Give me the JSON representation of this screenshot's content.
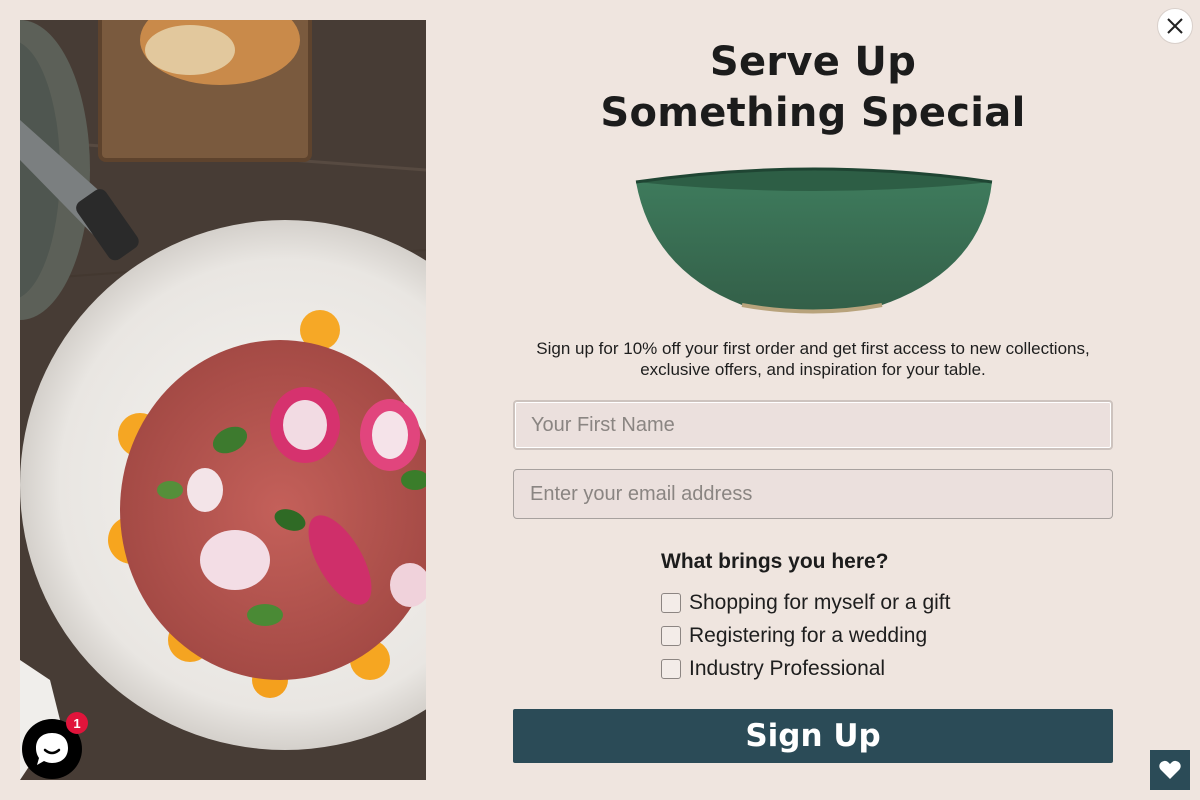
{
  "popup": {
    "headline_line1": "Serve Up",
    "headline_line2": "Something Special",
    "description": "Sign up for 10% off your first order and get first access to new collections, exclusive offers, and inspiration for your table.",
    "first_name_placeholder": "Your First Name",
    "email_placeholder": "Enter your email address",
    "question": "What brings you here?",
    "options": [
      {
        "label": "Shopping for myself or a gift",
        "checked": false
      },
      {
        "label": "Registering for a wedding",
        "checked": false
      },
      {
        "label": "Industry Professional",
        "checked": false
      }
    ],
    "submit_label": "Sign Up"
  },
  "chat": {
    "badge_count": "1",
    "icon": "chat-bubble-icon"
  },
  "wishlist": {
    "icon": "heart-icon"
  },
  "colors": {
    "background": "#efe5df",
    "button": "#2b4b57",
    "bowl_green": "#3f7a5c",
    "badge": "#e0143b"
  }
}
